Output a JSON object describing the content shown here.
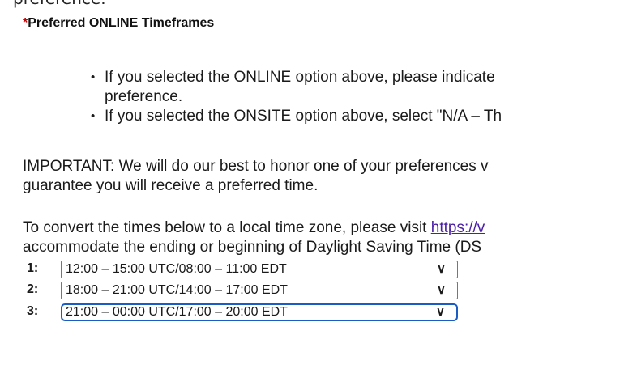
{
  "top_fragment": "preference.",
  "section": {
    "required_mark": "*",
    "title": "Preferred ONLINE Timeframes"
  },
  "bullets": [
    {
      "line1": "If you selected the ONLINE option above, please indicate",
      "line2": "preference."
    },
    {
      "line1": "If you selected the ONSITE option above, select \"N/A – Th"
    }
  ],
  "important": {
    "line1": "IMPORTANT: We will do our best to honor one of your preferences v",
    "line2": "guarantee you will receive a preferred time."
  },
  "convert": {
    "line1_prefix": "To convert the times below to a local time zone, please visit ",
    "link_text": "https://v",
    "line2": "accommodate the ending or beginning of Daylight Saving Time (DS"
  },
  "time_selects": [
    {
      "label": "1:",
      "value": "12:00 – 15:00 UTC/08:00 – 11:00 EDT"
    },
    {
      "label": "2:",
      "value": "18:00 – 21:00 UTC/14:00 – 17:00 EDT"
    },
    {
      "label": "3:",
      "value": "21:00 – 00:00 UTC/17:00 – 20:00 EDT"
    }
  ],
  "icons": {
    "dropdown": "chevron-down-icon"
  },
  "colors": {
    "required": "#cc0000",
    "link": "#4b1fa6",
    "focus_ring": "#1a5bc4"
  }
}
